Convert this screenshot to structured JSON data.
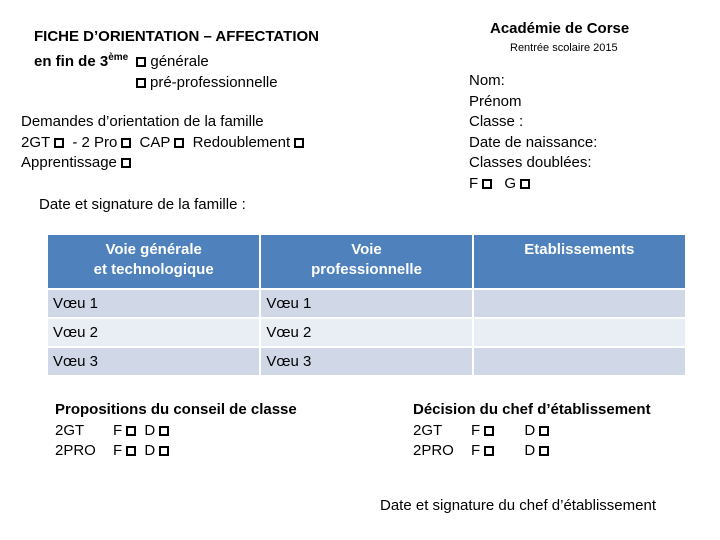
{
  "header": {
    "title_line1": "FICHE D’ORIENTATION – AFFECTATION",
    "title_line2_prefix": "en  fin de 3",
    "title_line2_sup": "ème",
    "option_generale": "générale",
    "option_preprof": "pré-professionnelle"
  },
  "academie": {
    "name": "Académie de Corse",
    "rentree": "Rentrée scolaire 2015"
  },
  "student": {
    "nom": "Nom:",
    "prenom": "Prénom",
    "classe": "Classe :",
    "naissance": "Date de naissance:",
    "doublees": "Classes doublées:",
    "opt_f": "F",
    "opt_g": "G"
  },
  "demandes": {
    "title": "Demandes d’orientation de la famille",
    "opt_2gt": "2GT",
    "opt_2pro": "- 2 Pro",
    "opt_cap": "CAP",
    "opt_redoublement": "Redoublement",
    "opt_apprentissage": "Apprentissage"
  },
  "signature_famille": "Date et signature de la famille :",
  "table": {
    "headers": [
      {
        "line1": "Voie générale",
        "line2": "et technologique"
      },
      {
        "line1": "Voie",
        "line2": "professionnelle"
      },
      {
        "line1": "Etablissements",
        "line2": ""
      }
    ],
    "rows": [
      [
        "Vœu 1",
        "Vœu 1",
        ""
      ],
      [
        "Vœu 2",
        "Vœu 2",
        ""
      ],
      [
        "Vœu 3",
        "Vœu 3",
        ""
      ]
    ]
  },
  "propositions": {
    "title": "Propositions du conseil de classe",
    "row1_label": "2GT",
    "row2_label": "2PRO",
    "opt_f": "F",
    "opt_d": "D"
  },
  "decision": {
    "title": "Décision du chef d’établissement",
    "row1_label": "2GT",
    "row2_label": "2PRO",
    "opt_f": "F",
    "opt_d": "D"
  },
  "signature_chef": "Date et signature du chef d’établissement"
}
